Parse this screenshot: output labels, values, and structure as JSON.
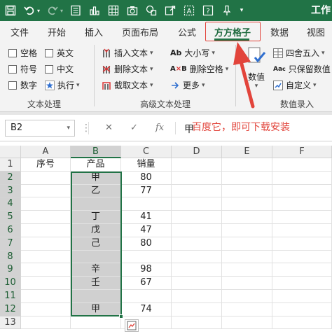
{
  "titlebar": {
    "title": "工作"
  },
  "tabs": [
    {
      "label": "文件"
    },
    {
      "label": "开始"
    },
    {
      "label": "插入"
    },
    {
      "label": "页面布局"
    },
    {
      "label": "公式"
    },
    {
      "label": "方方格子"
    },
    {
      "label": "数据"
    },
    {
      "label": "视图"
    }
  ],
  "active_tab": "方方格子",
  "ribbon": {
    "text_processing": {
      "checkboxes": [
        {
          "label": "空格"
        },
        {
          "label": "英文"
        },
        {
          "label": "符号"
        },
        {
          "label": "中文"
        },
        {
          "label": "数字"
        }
      ],
      "execute_label": "执行",
      "group_label": "文本处理"
    },
    "advanced_text": {
      "items": [
        {
          "label": "插入文本"
        },
        {
          "label": "删除文本"
        },
        {
          "label": "截取文本"
        },
        {
          "label": "大小写"
        },
        {
          "label": "删除空格"
        },
        {
          "label": "更多"
        }
      ],
      "group_label": "高级文本处理"
    },
    "data_entry": {
      "big_button_label": "数值",
      "items": [
        {
          "label": "四舍五入"
        },
        {
          "label": "只保留数值"
        },
        {
          "label": "自定义"
        }
      ],
      "group_label": "数值录入"
    }
  },
  "formula_bar": {
    "name_box": "B2",
    "value": "甲",
    "hint": "百度它，即可下载安装"
  },
  "sheet": {
    "columns": [
      "A",
      "B",
      "C",
      "D",
      "E",
      "F"
    ],
    "rows": [
      {
        "n": "1",
        "a": "序号",
        "b": "产品",
        "c": "销量"
      },
      {
        "n": "2",
        "a": "",
        "b": "甲",
        "c": "80"
      },
      {
        "n": "3",
        "a": "",
        "b": "乙",
        "c": "77"
      },
      {
        "n": "4",
        "a": "",
        "b": "",
        "c": ""
      },
      {
        "n": "5",
        "a": "",
        "b": "丁",
        "c": "41"
      },
      {
        "n": "6",
        "a": "",
        "b": "戊",
        "c": "47"
      },
      {
        "n": "7",
        "a": "",
        "b": "己",
        "c": "80"
      },
      {
        "n": "8",
        "a": "",
        "b": "",
        "c": ""
      },
      {
        "n": "9",
        "a": "",
        "b": "辛",
        "c": "98"
      },
      {
        "n": "10",
        "a": "",
        "b": "壬",
        "c": "67"
      },
      {
        "n": "11",
        "a": "",
        "b": "",
        "c": ""
      },
      {
        "n": "12",
        "a": "",
        "b": "甲",
        "c": "74"
      },
      {
        "n": "13",
        "a": "",
        "b": "",
        "c": ""
      }
    ]
  },
  "colors": {
    "excel_green": "#217346",
    "highlight_red": "#e2443b",
    "selection_gray": "#d0d0d0"
  }
}
